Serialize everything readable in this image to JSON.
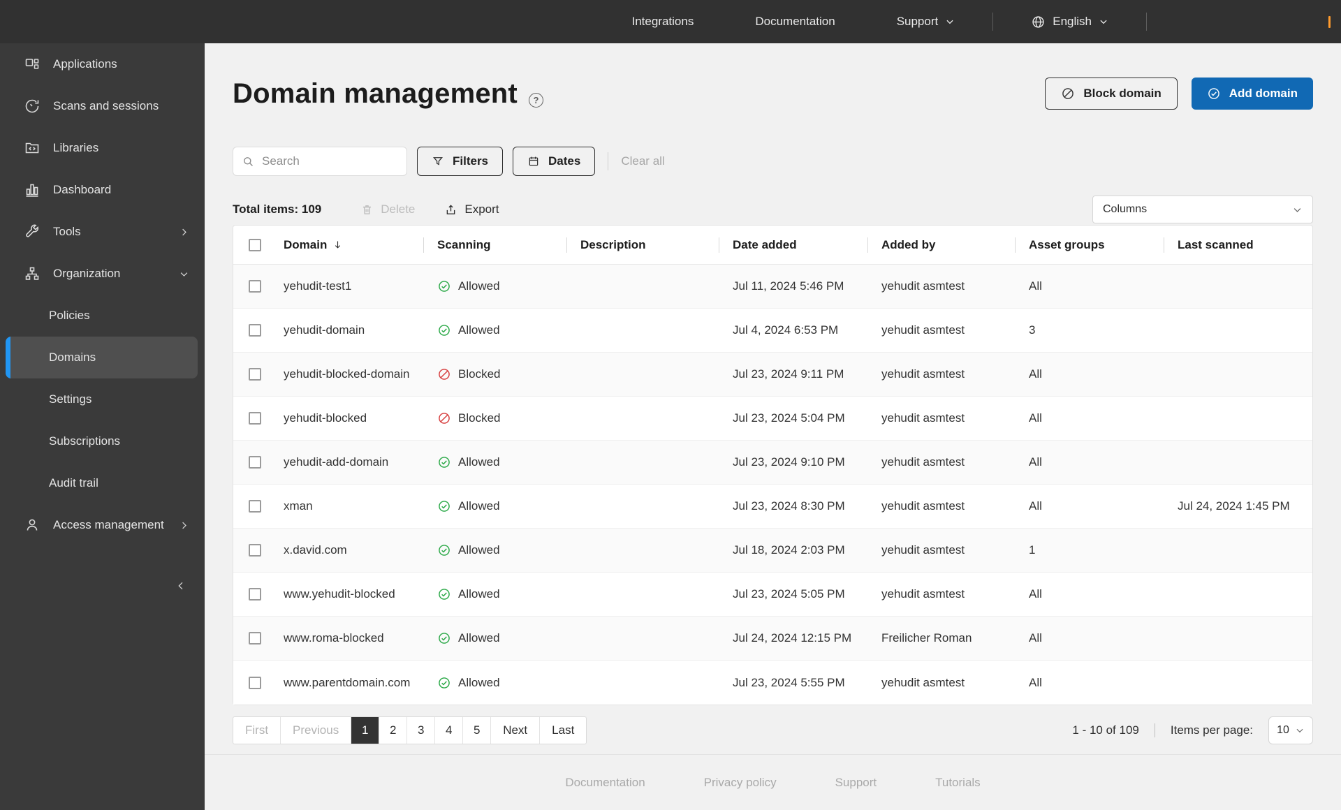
{
  "topbar": {
    "links": [
      "Integrations",
      "Documentation",
      "Support"
    ],
    "language": "English"
  },
  "sidebar": {
    "items": [
      "Applications",
      "Scans and sessions",
      "Libraries",
      "Dashboard",
      "Tools",
      "Organization"
    ],
    "organization_children": [
      "Policies",
      "Domains",
      "Settings",
      "Subscriptions",
      "Audit trail"
    ],
    "access_management": "Access management",
    "selected": "Domains"
  },
  "page": {
    "title": "Domain management"
  },
  "header_buttons": {
    "block": "Block domain",
    "add": "Add domain"
  },
  "toolbar": {
    "search_placeholder": "Search",
    "filters": "Filters",
    "dates": "Dates",
    "clear_all": "Clear all"
  },
  "actions_bar": {
    "total_items": "Total items: 109",
    "delete": "Delete",
    "export": "Export",
    "columns": "Columns"
  },
  "table": {
    "headers": [
      "Domain",
      "Scanning",
      "Description",
      "Date added",
      "Added by",
      "Asset groups",
      "Last scanned"
    ],
    "rows": [
      {
        "domain": "yehudit-test1",
        "scanning": "Allowed",
        "description": "",
        "date_added": "Jul 11, 2024 5:46 PM",
        "added_by": "yehudit asmtest",
        "asset_groups": "All",
        "last_scanned": ""
      },
      {
        "domain": "yehudit-domain",
        "scanning": "Allowed",
        "description": "",
        "date_added": "Jul 4, 2024 6:53 PM",
        "added_by": "yehudit asmtest",
        "asset_groups": "3",
        "last_scanned": ""
      },
      {
        "domain": "yehudit-blocked-domain",
        "scanning": "Blocked",
        "description": "",
        "date_added": "Jul 23, 2024 9:11 PM",
        "added_by": "yehudit asmtest",
        "asset_groups": "All",
        "last_scanned": ""
      },
      {
        "domain": "yehudit-blocked",
        "scanning": "Blocked",
        "description": "",
        "date_added": "Jul 23, 2024 5:04 PM",
        "added_by": "yehudit asmtest",
        "asset_groups": "All",
        "last_scanned": ""
      },
      {
        "domain": "yehudit-add-domain",
        "scanning": "Allowed",
        "description": "",
        "date_added": "Jul 23, 2024 9:10 PM",
        "added_by": "yehudit asmtest",
        "asset_groups": "All",
        "last_scanned": ""
      },
      {
        "domain": "xman",
        "scanning": "Allowed",
        "description": "",
        "date_added": "Jul 23, 2024 8:30 PM",
        "added_by": "yehudit asmtest",
        "asset_groups": "All",
        "last_scanned": "Jul 24, 2024 1:45 PM"
      },
      {
        "domain": "x.david.com",
        "scanning": "Allowed",
        "description": "",
        "date_added": "Jul 18, 2024 2:03 PM",
        "added_by": "yehudit asmtest",
        "asset_groups": "1",
        "last_scanned": ""
      },
      {
        "domain": "www.yehudit-blocked",
        "scanning": "Allowed",
        "description": "",
        "date_added": "Jul 23, 2024 5:05 PM",
        "added_by": "yehudit asmtest",
        "asset_groups": "All",
        "last_scanned": ""
      },
      {
        "domain": "www.roma-blocked",
        "scanning": "Allowed",
        "description": "",
        "date_added": "Jul 24, 2024 12:15 PM",
        "added_by": "Freilicher Roman",
        "asset_groups": "All",
        "last_scanned": ""
      },
      {
        "domain": "www.parentdomain.com",
        "scanning": "Allowed",
        "description": "",
        "date_added": "Jul 23, 2024 5:55 PM",
        "added_by": "yehudit asmtest",
        "asset_groups": "All",
        "last_scanned": ""
      }
    ]
  },
  "pagination": {
    "first": "First",
    "previous": "Previous",
    "pages": [
      "1",
      "2",
      "3",
      "4",
      "5"
    ],
    "current_page": "1",
    "next": "Next",
    "last": "Last",
    "range": "1 - 10 of 109",
    "items_per_page_label": "Items per page:",
    "items_per_page": "10"
  },
  "footer": {
    "links": [
      "Documentation",
      "Privacy policy",
      "Support",
      "Tutorials"
    ]
  },
  "icons": {
    "help_glyph": "?"
  },
  "colors": {
    "accent_blue": "#1169b4",
    "selected_item_accent": "#2196f3",
    "allowed_green": "#27a744",
    "blocked_red": "#d63a3a",
    "topbar_bg": "#313131",
    "sidebar_bg": "#3a3a3a"
  }
}
